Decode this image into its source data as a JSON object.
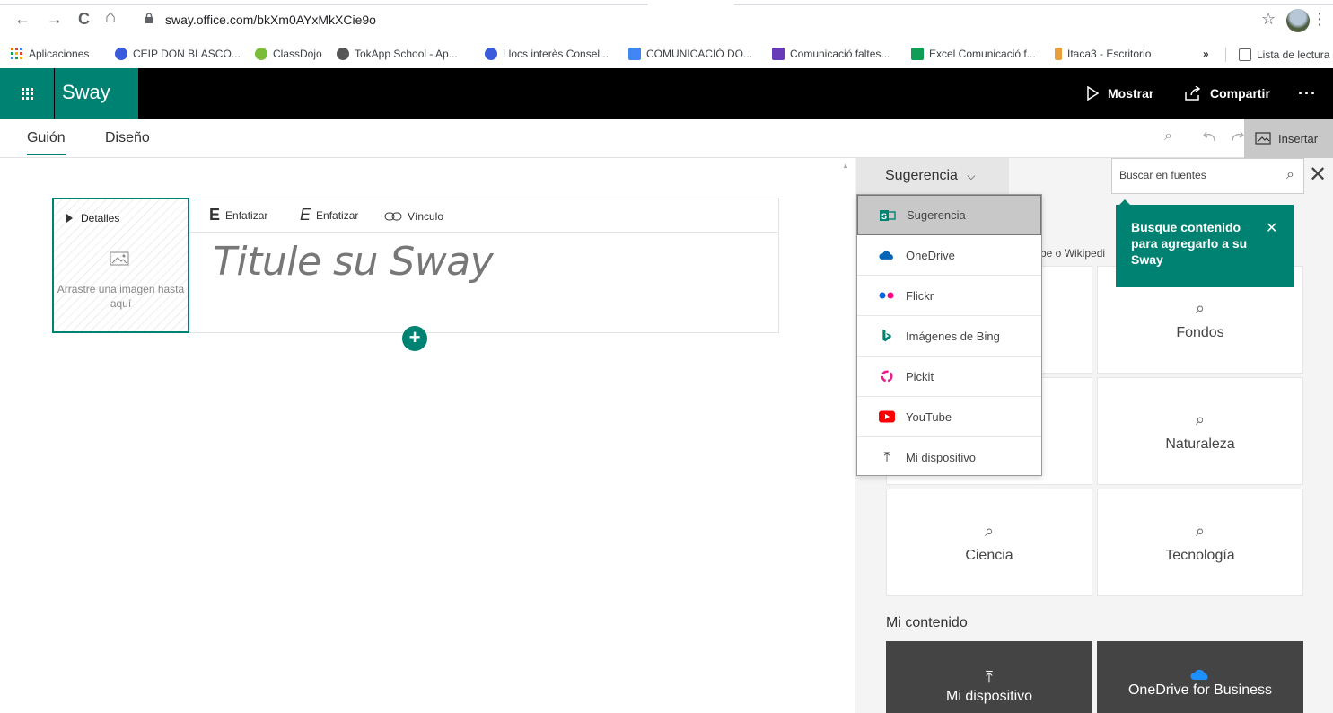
{
  "browser": {
    "url": "sway.office.com/bkXm0AYxMkXCie9o",
    "nav_back": "←",
    "nav_forward": "→",
    "nav_reload": "C",
    "nav_home": "⌂",
    "star": "☆",
    "menu": "⋮"
  },
  "bookmarks": [
    {
      "label": "Aplicaciones",
      "color": "#e37400"
    },
    {
      "label": "CEIP DON BLASCO...",
      "color": "#3b5bdb"
    },
    {
      "label": "ClassDojo",
      "color": "#7bbd3a"
    },
    {
      "label": "TokApp School - Ap...",
      "color": "#555555"
    },
    {
      "label": "Llocs interès Consel...",
      "color": "#3b5bdb"
    },
    {
      "label": "COMUNICACIÓ DO...",
      "color": "#4285f4"
    },
    {
      "label": "Comunicació faltes...",
      "color": "#673ab7"
    },
    {
      "label": "Excel Comunicació f...",
      "color": "#0f9d58"
    },
    {
      "label": "Itaca3 - Escritorio",
      "color": "#e89f3c"
    },
    {
      "label": "»",
      "color": ""
    },
    {
      "label": "Lista de lectura",
      "color": "#5f6368"
    }
  ],
  "header": {
    "brand": "Sway",
    "mostrar": "Mostrar",
    "compartir": "Compartir",
    "more": "···"
  },
  "toolbar": {
    "tab_guion": "Guión",
    "tab_diseno": "Diseño",
    "insertar": "Insertar"
  },
  "card": {
    "detalles": "Detalles",
    "drop_text": "Arrastre una imagen hasta aquí",
    "bold_label": "Enfatizar",
    "italic_label": "Enfatizar",
    "link_label": "Vínculo",
    "title_placeholder": "Titule su Sway",
    "bold_glyph": "E",
    "italic_glyph": "E"
  },
  "pane": {
    "source_selected": "Sugerencia",
    "search_placeholder": "Buscar en fuentes",
    "partial_text": "be o Wikipedi",
    "tiles": [
      {
        "label": "Fondos"
      },
      {
        "label": "Naturaleza"
      },
      {
        "label": "Ciencia"
      },
      {
        "label": "Tecnología"
      }
    ],
    "mi_contenido": "Mi contenido",
    "dark_tiles": [
      {
        "label": "Mi dispositivo"
      },
      {
        "label": "OneDrive for Business"
      }
    ]
  },
  "dropdown": {
    "items": [
      {
        "label": "Sugerencia",
        "icon": "sway-icon"
      },
      {
        "label": "OneDrive",
        "icon": "onedrive-icon"
      },
      {
        "label": "Flickr",
        "icon": "flickr-icon"
      },
      {
        "label": "Imágenes de Bing",
        "icon": "bing-icon"
      },
      {
        "label": "Pickit",
        "icon": "pickit-icon"
      },
      {
        "label": "YouTube",
        "icon": "youtube-icon"
      },
      {
        "label": "Mi dispositivo",
        "icon": "upload-icon"
      }
    ]
  },
  "tooltip": {
    "text": "Busque contenido para agregarlo a su Sway",
    "close": "✕"
  },
  "colors": {
    "accent": "#008272"
  }
}
